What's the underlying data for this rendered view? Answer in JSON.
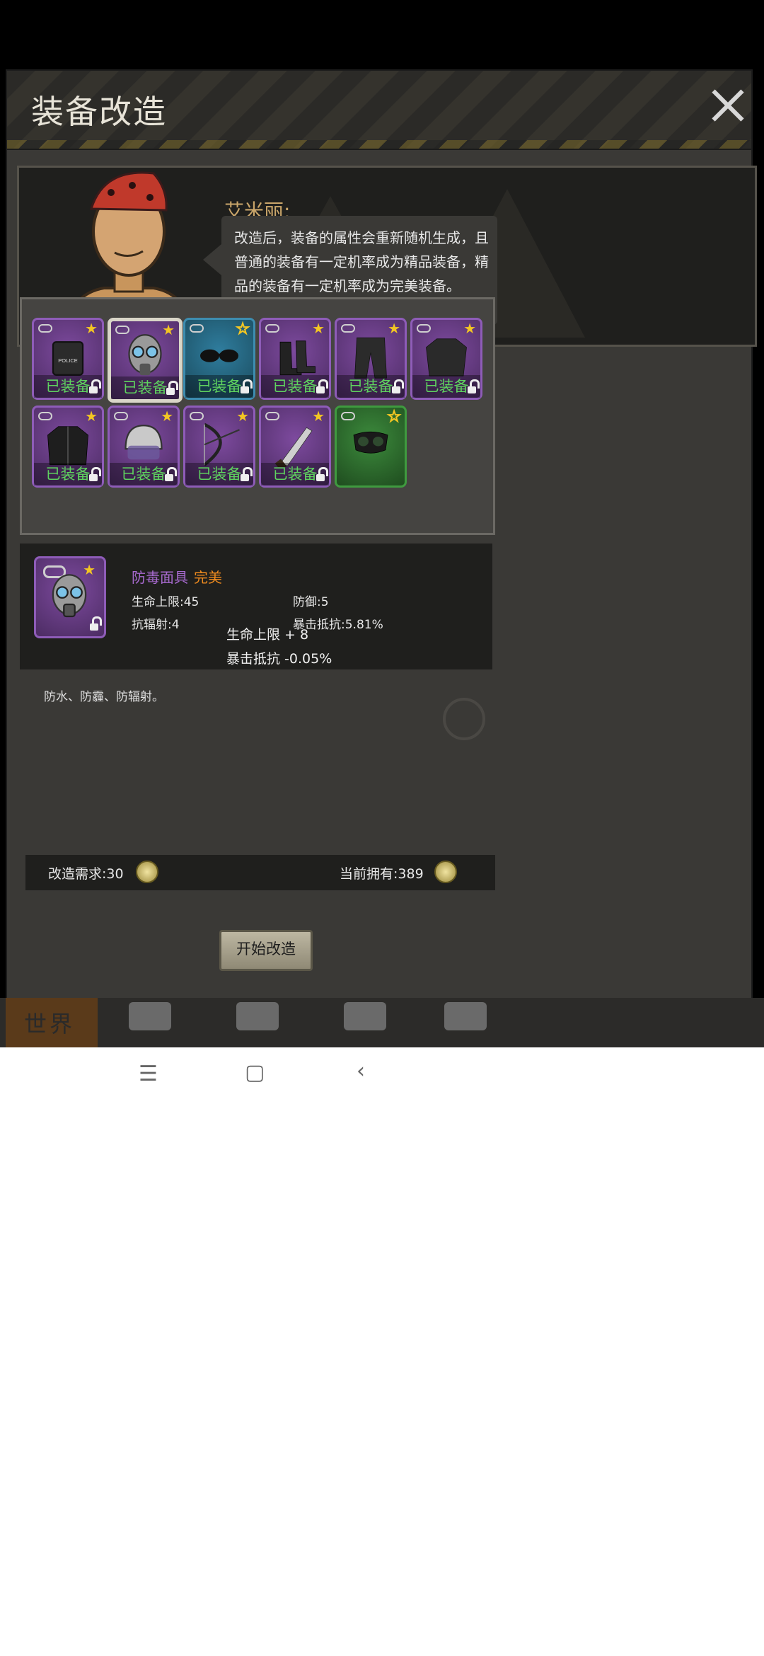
{
  "dialog": {
    "title": "装备改造",
    "close_icon": "close-icon"
  },
  "npc": {
    "name": "艾米丽:",
    "speech": "改造后，装备的属性会重新随机生成，且普通的装备有一定机率成为精品装备，精品的装备有一定机率成为完美装备。"
  },
  "inventory": {
    "slots": [
      {
        "item": "police-vest",
        "equipped_label": "已装备",
        "quality": "purple",
        "starred": true
      },
      {
        "item": "gas-mask",
        "equipped_label": "已装备",
        "quality": "purple",
        "starred": true,
        "selected": true
      },
      {
        "item": "sunglasses",
        "equipped_label": "已装备",
        "quality": "blue",
        "starred": false
      },
      {
        "item": "boots",
        "equipped_label": "已装备",
        "quality": "purple",
        "starred": true
      },
      {
        "item": "pants",
        "equipped_label": "已装备",
        "quality": "purple",
        "starred": true
      },
      {
        "item": "sweater",
        "equipped_label": "已装备",
        "quality": "purple",
        "starred": true
      },
      {
        "item": "jacket",
        "equipped_label": "已装备",
        "quality": "purple",
        "starred": true
      },
      {
        "item": "police-helmet",
        "equipped_label": "已装备",
        "quality": "purple",
        "starred": true
      },
      {
        "item": "compound-bow",
        "equipped_label": "已装备",
        "quality": "purple",
        "starred": true
      },
      {
        "item": "machete",
        "equipped_label": "已装备",
        "quality": "purple",
        "starred": true
      },
      {
        "item": "goggles",
        "equipped_label": "",
        "quality": "green",
        "starred": false
      }
    ]
  },
  "selected_item": {
    "name": "防毒面具",
    "quality": "完美",
    "stats": {
      "hp_max": "生命上限:45",
      "defense": "防御:5",
      "rad_resist": "抗辐射:4",
      "crit_resist": "暴击抵抗:5.81%"
    },
    "changes": {
      "hp_max": "生命上限 + 8",
      "crit_resist": "暴击抵抗 -0.05%"
    },
    "description": "防水、防霾、防辐射。"
  },
  "cost": {
    "required": "改造需求:30",
    "owned": "当前拥有:389"
  },
  "start_button": "开始改造",
  "tabs": {
    "world": "世界"
  },
  "colors": {
    "purple_quality": "#a86ad0",
    "perfect_quality": "#f08b1e",
    "equipped_text": "#5fd35f",
    "npc_name": "#c9a56a"
  }
}
